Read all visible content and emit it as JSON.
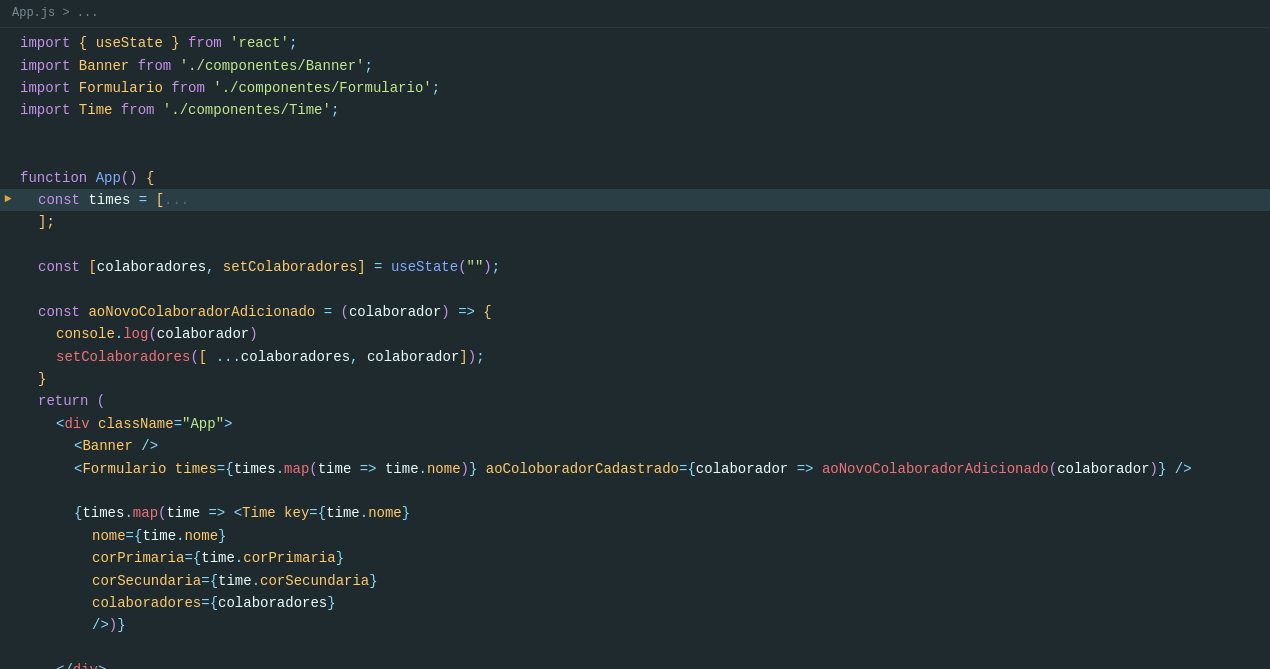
{
  "breadcrumb": {
    "path": "App.js > ..."
  },
  "colors": {
    "background": "#1e2a2e",
    "highlight_line": "#2a3f45",
    "keyword": "#c792ea",
    "string": "#c3e88d",
    "variable": "#eeffff",
    "component": "#ffcb6b",
    "operator": "#89ddff",
    "comment": "#546e7a"
  }
}
